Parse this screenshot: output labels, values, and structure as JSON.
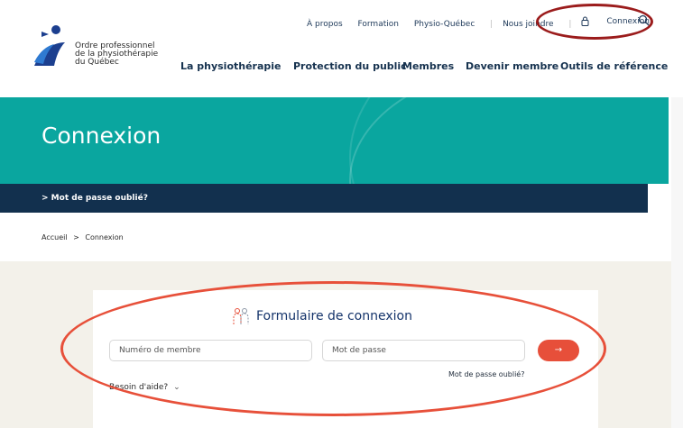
{
  "header": {
    "logo": {
      "line1": "Ordre professionnel",
      "line2": "de la physiothérapie",
      "line3": "du Québec"
    },
    "top_nav": [
      {
        "label": "À propos"
      },
      {
        "label": "Formation"
      },
      {
        "label": "Physio-Québec"
      },
      {
        "label": "Nous joindre"
      }
    ],
    "connexion_label": "Connexion",
    "main_nav": [
      {
        "label": "La physiothérapie"
      },
      {
        "label": "Protection du public"
      },
      {
        "label": "Membres"
      },
      {
        "label": "Devenir membre"
      },
      {
        "label": "Outils de référence"
      }
    ]
  },
  "hero": {
    "title": "Connexion"
  },
  "subbar": {
    "link": "> Mot de passe oublié?"
  },
  "breadcrumb": {
    "home": "Accueil",
    "sep": ">",
    "current": "Connexion"
  },
  "form": {
    "title": "Formulaire de connexion",
    "member_placeholder": "Numéro de membre",
    "password_placeholder": "Mot de passe",
    "submit_label": "→",
    "forgot": "Mot de passe oublié?",
    "help": "Besoin d'aide?",
    "help_chevron": "⌄"
  },
  "colors": {
    "teal": "#0aa69f",
    "navy": "#12304e",
    "accent": "#e74f3a",
    "annotation_red": "#9b1c1c"
  }
}
